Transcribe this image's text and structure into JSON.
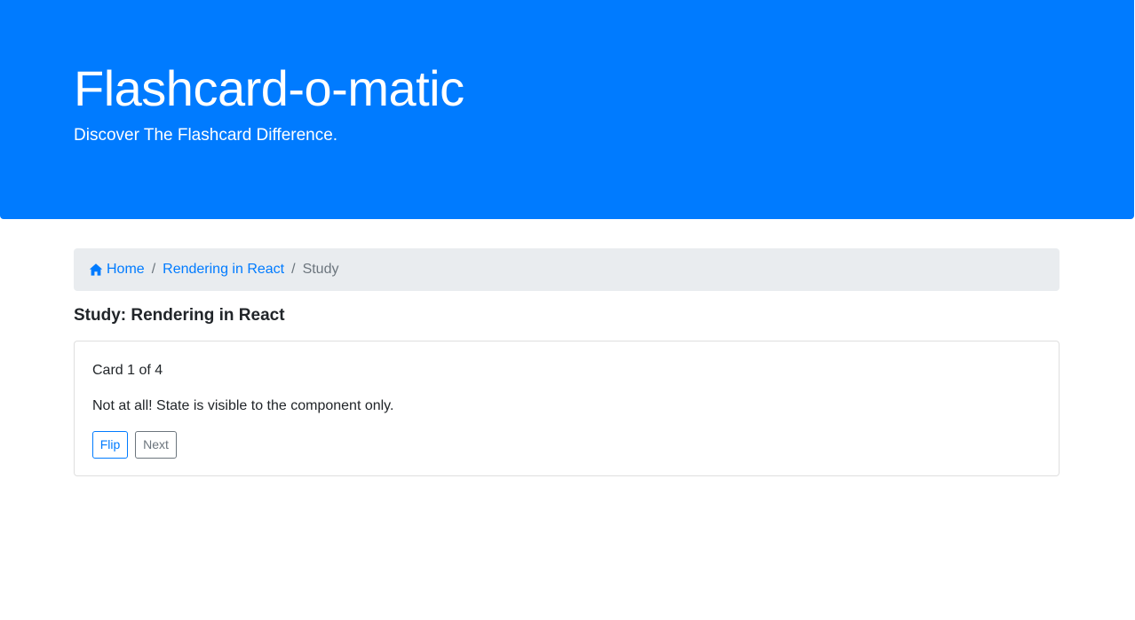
{
  "header": {
    "title": "Flashcard-o-matic",
    "subtitle": "Discover The Flashcard Difference."
  },
  "breadcrumb": {
    "home_icon": "home-icon",
    "items": [
      {
        "label": "Home",
        "link": true
      },
      {
        "label": "Rendering in React",
        "link": true
      },
      {
        "label": "Study",
        "link": false
      }
    ]
  },
  "study": {
    "title": "Study: Rendering in React",
    "card": {
      "counter": "Card 1 of 4",
      "text": "Not at all! State is visible to the component only.",
      "flip_label": "Flip",
      "next_label": "Next"
    }
  },
  "colors": {
    "primary": "#007bff",
    "secondary": "#6c757d",
    "breadcrumb_bg": "#e9ecef"
  }
}
